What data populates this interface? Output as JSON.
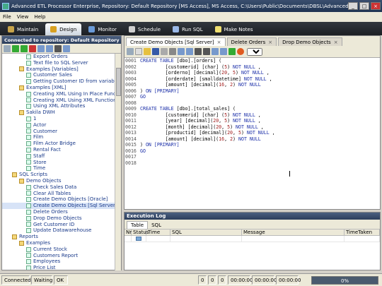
{
  "window": {
    "title": "Advanced ETL Processor Enterprise, Repository: Default Repository [MS Access], MS Access, C:\\Users\\Public\\Documents\\DBSL\\Advanced ETL Processor\\Repos..."
  },
  "menu": [
    "File",
    "View",
    "Help"
  ],
  "main_tabs": [
    {
      "label": "Maintain",
      "icon": "wrench-icon",
      "color": "#c8a44a"
    },
    {
      "label": "Design",
      "icon": "palette-icon",
      "color": "#d8a020"
    },
    {
      "label": "Monitor",
      "icon": "monitor-icon",
      "color": "#6a9ad8"
    },
    {
      "label": "Schedule",
      "icon": "clock-icon",
      "color": "#cfcfcf"
    },
    {
      "label": "Run SQL",
      "icon": "database-icon",
      "color": "#9ab8e8"
    },
    {
      "label": "Make Notes",
      "icon": "notes-icon",
      "color": "#f0e070"
    }
  ],
  "repo_panel": {
    "header": "Connected to repository: Default Repository [M..."
  },
  "tree": [
    {
      "label": "Export Orders",
      "indent": 3,
      "kind": "item"
    },
    {
      "label": "Text file to SQL Server",
      "indent": 3,
      "kind": "item"
    },
    {
      "label": "Examples [Variables]",
      "indent": 2,
      "kind": "folder"
    },
    {
      "label": "Customer Sales",
      "indent": 3,
      "kind": "item"
    },
    {
      "label": "Getting Customer ID from variable",
      "indent": 3,
      "kind": "item"
    },
    {
      "label": "Examples [XML]",
      "indent": 2,
      "kind": "folder"
    },
    {
      "label": "Creating XML Using In Place Function",
      "indent": 3,
      "kind": "item"
    },
    {
      "label": "Creating XML Using XML Functions",
      "indent": 3,
      "kind": "item"
    },
    {
      "label": "Using XML Attributes",
      "indent": 3,
      "kind": "item"
    },
    {
      "label": "Sakila DWH",
      "indent": 2,
      "kind": "folder"
    },
    {
      "label": "1",
      "indent": 3,
      "kind": "item"
    },
    {
      "label": "Actor",
      "indent": 3,
      "kind": "item"
    },
    {
      "label": "Customer",
      "indent": 3,
      "kind": "item"
    },
    {
      "label": "Film",
      "indent": 3,
      "kind": "item"
    },
    {
      "label": "Film Actor Bridge",
      "indent": 3,
      "kind": "item"
    },
    {
      "label": "Rental Fact",
      "indent": 3,
      "kind": "item"
    },
    {
      "label": "Staff",
      "indent": 3,
      "kind": "item"
    },
    {
      "label": "Store",
      "indent": 3,
      "kind": "item"
    },
    {
      "label": "Time",
      "indent": 3,
      "kind": "item"
    },
    {
      "label": "SQL Scripts",
      "indent": 1,
      "kind": "folder"
    },
    {
      "label": "Demo Objects",
      "indent": 2,
      "kind": "folder"
    },
    {
      "label": "Check Sales Data",
      "indent": 3,
      "kind": "item"
    },
    {
      "label": "Clear All Tables",
      "indent": 3,
      "kind": "item"
    },
    {
      "label": "Create Demo Objects [Oracle]",
      "indent": 3,
      "kind": "item"
    },
    {
      "label": "Create Demo Objects [Sql Server]",
      "indent": 3,
      "kind": "item",
      "selected": true
    },
    {
      "label": "Delete Orders",
      "indent": 3,
      "kind": "item"
    },
    {
      "label": "Drop Demo Objects",
      "indent": 3,
      "kind": "item"
    },
    {
      "label": "Get Customer ID",
      "indent": 3,
      "kind": "item"
    },
    {
      "label": "Update Datawarehouse",
      "indent": 3,
      "kind": "item"
    },
    {
      "label": "Reports",
      "indent": 1,
      "kind": "folder"
    },
    {
      "label": "Examples",
      "indent": 2,
      "kind": "folder"
    },
    {
      "label": "Current Stock",
      "indent": 3,
      "kind": "item"
    },
    {
      "label": "Customers Report",
      "indent": 3,
      "kind": "item"
    },
    {
      "label": "Employees",
      "indent": 3,
      "kind": "item"
    },
    {
      "label": "Price List",
      "indent": 3,
      "kind": "item"
    }
  ],
  "doc_tabs": [
    {
      "label": "Create Demo Objects [Sql Server]",
      "active": true
    },
    {
      "label": "Delete Orders",
      "active": false
    },
    {
      "label": "Drop Demo Objects",
      "active": false
    }
  ],
  "editor": {
    "go_option": "GO",
    "lines": [
      {
        "n": "0001",
        "t": "CREATE TABLE [dbo].[orders] ("
      },
      {
        "n": "0002",
        "t": "         [customerid] [char] (5) NOT NULL ,"
      },
      {
        "n": "0003",
        "t": "         [orderno] [decimal](20, 5) NOT NULL ,"
      },
      {
        "n": "0004",
        "t": "         [orderdate] [smalldatetime] NOT NULL ,"
      },
      {
        "n": "0005",
        "t": "         [amount] [decimal](16, 2) NOT NULL"
      },
      {
        "n": "0006",
        "t": ") ON [PRIMARY]"
      },
      {
        "n": "0007",
        "t": "GO"
      },
      {
        "n": "0008",
        "t": ""
      },
      {
        "n": "0009",
        "t": "CREATE TABLE [dbo].[total_sales] ("
      },
      {
        "n": "0010",
        "t": "         [customerid] [char] (5) NOT NULL ,"
      },
      {
        "n": "0011",
        "t": "         [year] [decimal](20, 5) NOT NULL ,"
      },
      {
        "n": "0012",
        "t": "         [month] [decimal](20, 5) NOT NULL ,"
      },
      {
        "n": "0013",
        "t": "         [productid] [decimal](20, 5) NOT NULL ,"
      },
      {
        "n": "0014",
        "t": "         [amount] [decimal](16, 2) NOT NULL"
      },
      {
        "n": "0015",
        "t": ") ON [PRIMARY]"
      },
      {
        "n": "0016",
        "t": "GO"
      },
      {
        "n": "0017",
        "t": ""
      },
      {
        "n": "0018",
        "t": ""
      }
    ]
  },
  "log": {
    "header": "Execution Log",
    "tabs": [
      "Table",
      "SQL"
    ],
    "columns": [
      "Nr",
      "Status",
      "Time",
      "SQL",
      "Message",
      "TimeTaken"
    ]
  },
  "status": {
    "connection": "Connected",
    "state": "Waiting",
    "ok": "OK",
    "counters": [
      "0",
      "0",
      "0",
      "00:00:00",
      "00:00:00",
      "00:00:00"
    ],
    "progress": "0%"
  }
}
